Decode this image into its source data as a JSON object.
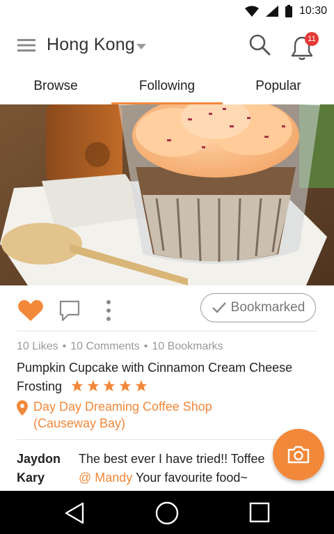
{
  "status_bar": {
    "time": "10:30"
  },
  "app_bar": {
    "city": "Hong Kong",
    "notification_count": "11"
  },
  "tabs": [
    {
      "label": "Browse",
      "active": false
    },
    {
      "label": "Following",
      "active": true
    },
    {
      "label": "Popular",
      "active": false
    }
  ],
  "post": {
    "bookmark_label": "Bookmarked",
    "likes": "10 Likes",
    "comments": "10 Comments",
    "bookmarks": "10 Bookmarks",
    "title_line1": "Pumpkin Cupcake with Cinnamon Cream Cheese",
    "title_line2": "Frosting",
    "rating": 5,
    "location_line1": "Day Day Dreaming Coffee Shop",
    "location_line2": "(Causeway Bay)"
  },
  "comments": [
    {
      "user": "Jaydon",
      "text": "The best ever I have tried!! Toffee"
    },
    {
      "user": "Kary",
      "mention": "@ Mandy",
      "text": " Your favourite food~"
    }
  ],
  "colors": {
    "accent": "#f2883a",
    "badge": "#e53935",
    "text": "#222222",
    "muted": "#999999"
  }
}
